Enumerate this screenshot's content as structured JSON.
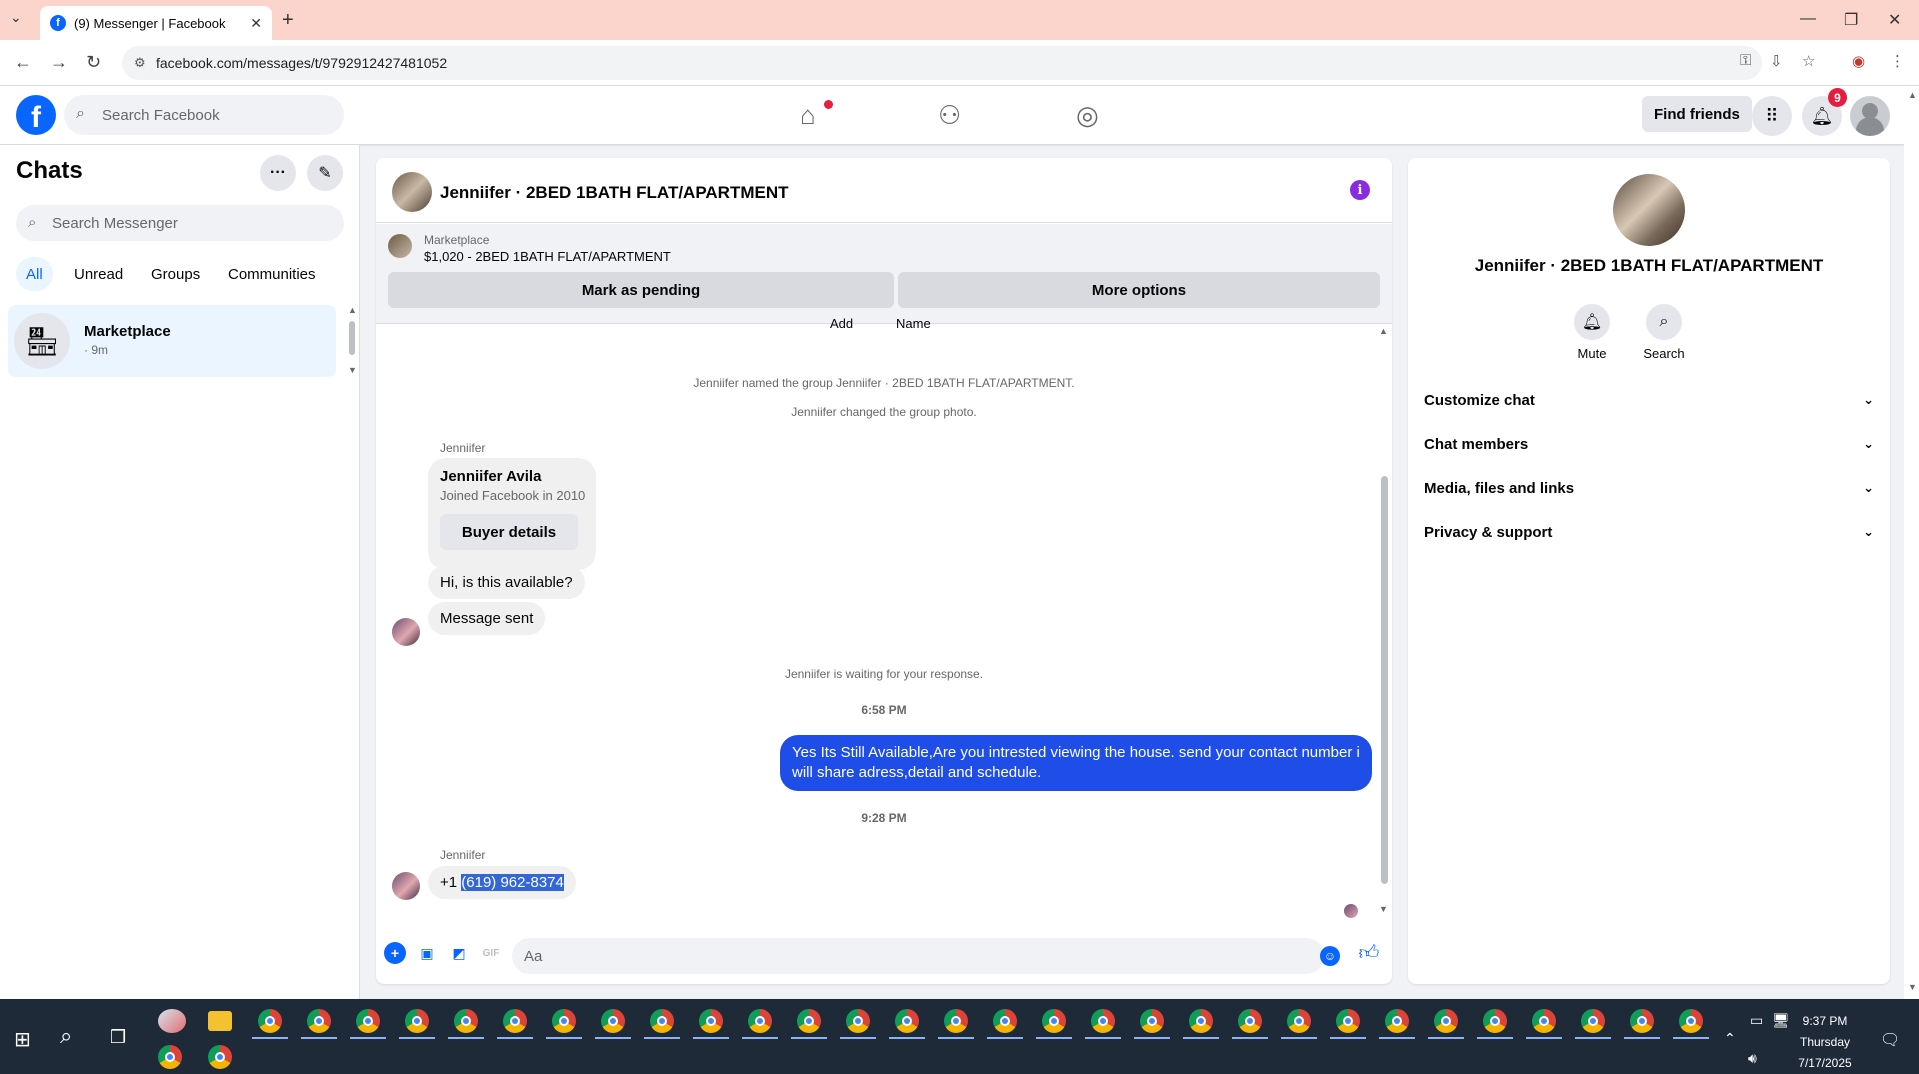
{
  "browser": {
    "tab_title": "(9) Messenger | Facebook",
    "url": "facebook.com/messages/t/9792912427481052"
  },
  "fb_header": {
    "search_placeholder": "Search Facebook",
    "find_friends": "Find friends",
    "notification_count": "9"
  },
  "chats_panel": {
    "title": "Chats",
    "search_placeholder": "Search Messenger",
    "filters": [
      "All",
      "Unread",
      "Groups",
      "Communities"
    ],
    "active_filter": "All",
    "items": [
      {
        "name": "Marketplace",
        "time": "· 9m"
      }
    ]
  },
  "conversation": {
    "title": "Jenniifer · 2BED 1BATH FLAT/APARTMENT",
    "marketplace": {
      "label": "Marketplace",
      "listing": "$1,020 - 2BED 1BATH FLAT/APARTMENT",
      "mark_pending": "Mark as pending",
      "more_options": "More options"
    },
    "partial_labels": [
      "Add",
      "Name"
    ],
    "system_1": "Jenniifer named the group Jenniifer · 2BED 1BATH FLAT/APARTMENT.",
    "system_2": "Jenniifer changed the group photo.",
    "sender_1": "Jenniifer",
    "profile_card": {
      "name": "Jenniifer Avila",
      "joined": "Joined Facebook in 2010",
      "button": "Buyer details"
    },
    "msg_1": "Hi, is this available?",
    "msg_2": "Message sent",
    "system_3": "Jenniifer is waiting for your response.",
    "time_1": "6:58 PM",
    "out_msg": "Yes Its Still Available,Are you intrested viewing the house. send your contact number i will share adress,detail and schedule.",
    "time_2": "9:28 PM",
    "sender_2": "Jenniifer",
    "phone_prefix": "+1 ",
    "phone_number": "(619) 962-8374",
    "composer_placeholder": "Aa"
  },
  "info_panel": {
    "title": "Jenniifer · 2BED 1BATH FLAT/APARTMENT",
    "mute": "Mute",
    "search": "Search",
    "sections": [
      "Customize chat",
      "Chat members",
      "Media, files and links",
      "Privacy & support"
    ]
  },
  "taskbar": {
    "time": "9:37 PM",
    "day": "Thursday",
    "date": "7/17/2025"
  },
  "colors": {
    "fb_blue": "#0866ff",
    "outgoing_bubble": "#1e4de8",
    "notification_red": "#e41e3f",
    "tab_bar": "#fbd5cc"
  }
}
